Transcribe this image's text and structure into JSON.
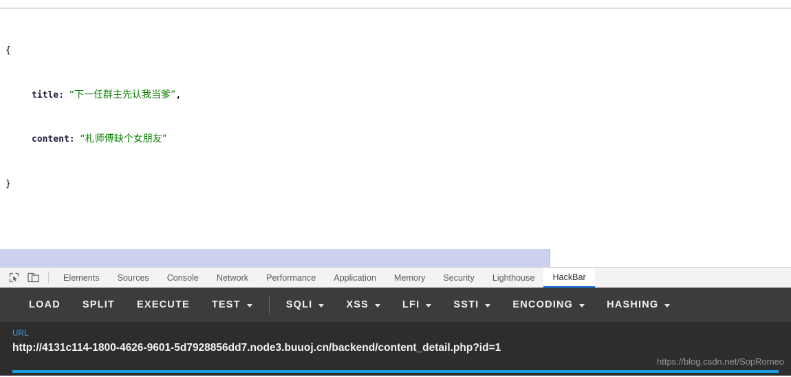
{
  "page": {
    "json_open_brace": "{",
    "json_close_brace": "}",
    "fields": [
      {
        "key": "title:",
        "value": "“下一任群主先认我当爹”",
        "comma": ","
      },
      {
        "key": "content:",
        "value": "“札师傅缺个女朋友”",
        "comma": ""
      }
    ]
  },
  "devtools": {
    "icons": [
      {
        "name": "inspect-element-icon",
        "label": "inspect-element"
      },
      {
        "name": "device-toolbar-icon",
        "label": "toggle-device-toolbar"
      }
    ],
    "tabs": [
      {
        "label": "Elements",
        "active": false
      },
      {
        "label": "Sources",
        "active": false
      },
      {
        "label": "Console",
        "active": false
      },
      {
        "label": "Network",
        "active": false
      },
      {
        "label": "Performance",
        "active": false
      },
      {
        "label": "Application",
        "active": false
      },
      {
        "label": "Memory",
        "active": false
      },
      {
        "label": "Security",
        "active": false
      },
      {
        "label": "Lighthouse",
        "active": false
      },
      {
        "label": "HackBar",
        "active": true
      }
    ]
  },
  "hackbar": {
    "buttons": [
      {
        "label": "LOAD",
        "has_caret": false,
        "separator_after": false
      },
      {
        "label": "SPLIT",
        "has_caret": false,
        "separator_after": false
      },
      {
        "label": "EXECUTE",
        "has_caret": false,
        "separator_after": false
      },
      {
        "label": "TEST",
        "has_caret": true,
        "separator_after": true
      },
      {
        "label": "SQLI",
        "has_caret": true,
        "separator_after": false
      },
      {
        "label": "XSS",
        "has_caret": true,
        "separator_after": false
      },
      {
        "label": "LFI",
        "has_caret": true,
        "separator_after": false
      },
      {
        "label": "SSTI",
        "has_caret": true,
        "separator_after": false
      },
      {
        "label": "ENCODING",
        "has_caret": true,
        "separator_after": false
      },
      {
        "label": "HASHING",
        "has_caret": true,
        "separator_after": false
      }
    ],
    "url_label": "URL",
    "url_value": "http://4131c114-1800-4626-9601-5d7928856dd7.node3.buuoj.cn/backend/content_detail.php?id=1"
  },
  "watermark": {
    "text": "https://blog.csdn.net/SopRomeo"
  },
  "colors": {
    "accent_blue": "#1a9be0",
    "tab_active_blue": "#1a73e8",
    "json_value_green": "#0a8000",
    "toolbar_bg": "#3c3c3c",
    "url_panel_bg": "#2d2d2d",
    "selection_lavender": "#cdd0ee"
  }
}
